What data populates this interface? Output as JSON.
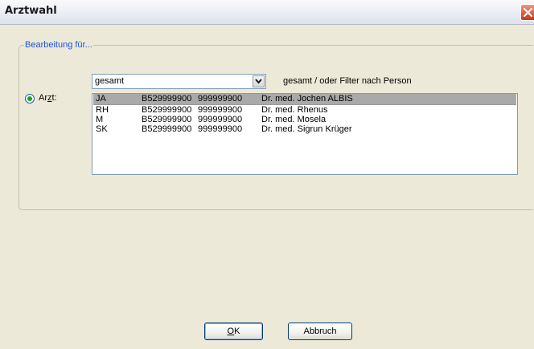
{
  "window": {
    "title": "Arztwahl"
  },
  "group": {
    "legend": "Bearbeitung für..."
  },
  "filter": {
    "selected_value": "gesamt",
    "hint": "gesamt / oder Filter nach Person"
  },
  "radio": {
    "label_prefix": "Ar",
    "label_mnemonic": "z",
    "label_suffix": "t:",
    "checked": true
  },
  "doctors": [
    {
      "code": "JA",
      "nr1": "B529999900",
      "nr2": "999999900",
      "name": "Dr. med. Jochen ALBIS",
      "selected": true
    },
    {
      "code": "RH",
      "nr1": "B529999900",
      "nr2": "999999900",
      "name": "Dr. med. Rhenus",
      "selected": false
    },
    {
      "code": "M",
      "nr1": "B529999900",
      "nr2": "999999900",
      "name": "Dr. med. Mosela",
      "selected": false
    },
    {
      "code": "SK",
      "nr1": "B529999900",
      "nr2": "999999900",
      "name": "Dr. med. Sigrun Krüger",
      "selected": false
    }
  ],
  "buttons": {
    "ok_mnemonic": "O",
    "ok_rest": "K",
    "cancel": "Abbruch"
  },
  "colors": {
    "legend": "#1e52d6",
    "selection": "#a9a9a9",
    "radio_dot": "#21a121",
    "close_button": "#dd5a3a"
  },
  "icons": {
    "close": "close-x-icon",
    "dropdown": "chevron-down-icon"
  }
}
